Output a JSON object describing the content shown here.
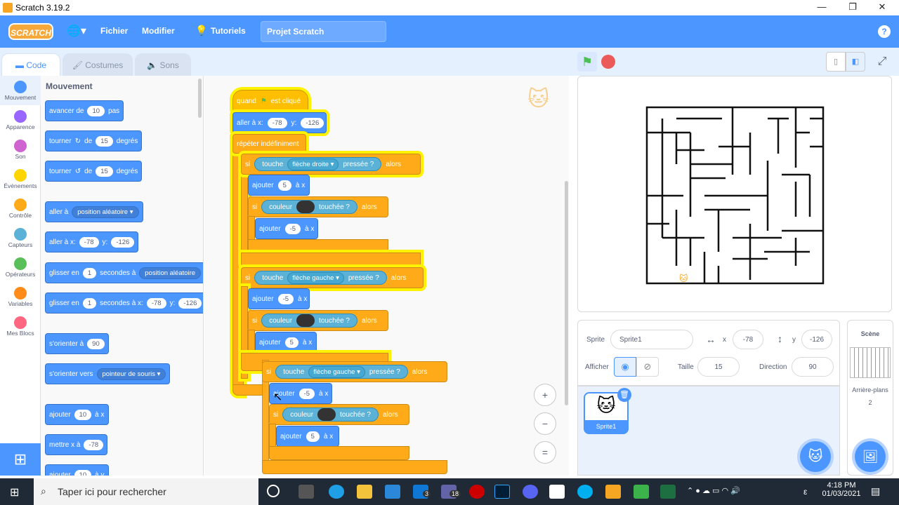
{
  "window": {
    "title": "Scratch 3.19.2"
  },
  "menu": {
    "logo": "SCRATCH",
    "file": "Fichier",
    "edit": "Modifier",
    "tutorials": "Tutoriels",
    "project_title": "Projet Scratch",
    "help": "?"
  },
  "tabs": {
    "code": "Code",
    "costumes": "Costumes",
    "sounds": "Sons"
  },
  "categories": [
    {
      "label": "Mouvement",
      "color": "#4c97ff"
    },
    {
      "label": "Apparence",
      "color": "#9966ff"
    },
    {
      "label": "Son",
      "color": "#cf63cf"
    },
    {
      "label": "Événements",
      "color": "#ffd500"
    },
    {
      "label": "Contrôle",
      "color": "#ffab19"
    },
    {
      "label": "Capteurs",
      "color": "#5cb1d6"
    },
    {
      "label": "Opérateurs",
      "color": "#59c059"
    },
    {
      "label": "Variables",
      "color": "#ff8c1a"
    },
    {
      "label": "Mes Blocs",
      "color": "#ff6680"
    }
  ],
  "palette": {
    "heading": "Mouvement",
    "move": {
      "a": "avancer de",
      "v": "10",
      "b": "pas"
    },
    "turn_right": {
      "a": "tourner",
      "b": "de",
      "v": "15",
      "c": "degrés"
    },
    "turn_left": {
      "a": "tourner",
      "b": "de",
      "v": "15",
      "c": "degrés"
    },
    "goto_menu": {
      "a": "aller à",
      "dd": "position aléatoire"
    },
    "goto_xy": {
      "a": "aller à x:",
      "x": "-78",
      "b": "y:",
      "y": "-126"
    },
    "glide_menu": {
      "a": "glisser en",
      "v": "1",
      "b": "secondes à",
      "dd": "position aléatoire"
    },
    "glide_xy": {
      "a": "glisser en",
      "v": "1",
      "b": "secondes à x:",
      "x": "-78",
      "c": "y:",
      "y": "-126"
    },
    "point_dir": {
      "a": "s'orienter à",
      "v": "90"
    },
    "point_towards": {
      "a": "s'orienter vers",
      "dd": "pointeur de souris"
    },
    "change_x": {
      "a": "ajouter",
      "v": "10",
      "b": "à x"
    },
    "set_x": {
      "a": "mettre x à",
      "v": "-78"
    },
    "change_y": {
      "a": "ajouter",
      "v": "10",
      "b": "à y"
    }
  },
  "script": {
    "hat": {
      "a": "quand",
      "b": "est cliqué"
    },
    "goto": {
      "a": "aller à x:",
      "x": "-78",
      "b": "y:",
      "y": "-126"
    },
    "forever": "répéter indéfiniment",
    "if1": {
      "si": "si",
      "touche": "touche",
      "key": "flèche droite",
      "pressed": "pressée ?",
      "alors": "alors"
    },
    "add1": {
      "a": "ajouter",
      "v": "5",
      "b": "à x"
    },
    "if1b": {
      "si": "si",
      "couleur": "couleur",
      "touched": "touchée ?",
      "alors": "alors"
    },
    "add1b": {
      "a": "ajouter",
      "v": "-5",
      "b": "à x"
    },
    "if2": {
      "si": "si",
      "touche": "touche",
      "key": "flèche gauche",
      "pressed": "pressée ?",
      "alors": "alors"
    },
    "add2": {
      "a": "ajouter",
      "v": "-5",
      "b": "à x"
    },
    "if2b": {
      "si": "si",
      "couleur": "couleur",
      "touched": "touchée ?",
      "alors": "alors"
    },
    "add2b": {
      "a": "ajouter",
      "v": "5",
      "b": "à x"
    }
  },
  "dragged": {
    "if": {
      "si": "si",
      "touche": "touche",
      "key": "flèche gauche",
      "pressed": "pressée ?",
      "alors": "alors"
    },
    "add": {
      "a": "ajouter",
      "v": "-5",
      "b": "à x"
    },
    "ifb": {
      "si": "si",
      "couleur": "couleur",
      "touched": "touchée ?",
      "alors": "alors"
    },
    "addb": {
      "a": "ajouter",
      "v": "5",
      "b": "à x"
    }
  },
  "zoom": {
    "in": "+",
    "out": "−",
    "reset": "="
  },
  "sprite_info": {
    "sprite_label": "Sprite",
    "sprite_name": "Sprite1",
    "x_label": "x",
    "x": "-78",
    "y_label": "y",
    "y": "-126",
    "show_label": "Afficher",
    "size_label": "Taille",
    "size": "15",
    "direction_label": "Direction",
    "direction": "90"
  },
  "sprite_list": [
    {
      "name": "Sprite1"
    }
  ],
  "stage_pane": {
    "title": "Scène",
    "backdrops_label": "Arrière-plans",
    "backdrops_count": "2"
  },
  "taskbar": {
    "search_placeholder": "Taper ici pour rechercher",
    "time": "4:18 PM",
    "date": "01/03/2021",
    "badge_mail": "3",
    "badge_files": "18",
    "lang": "ε"
  }
}
